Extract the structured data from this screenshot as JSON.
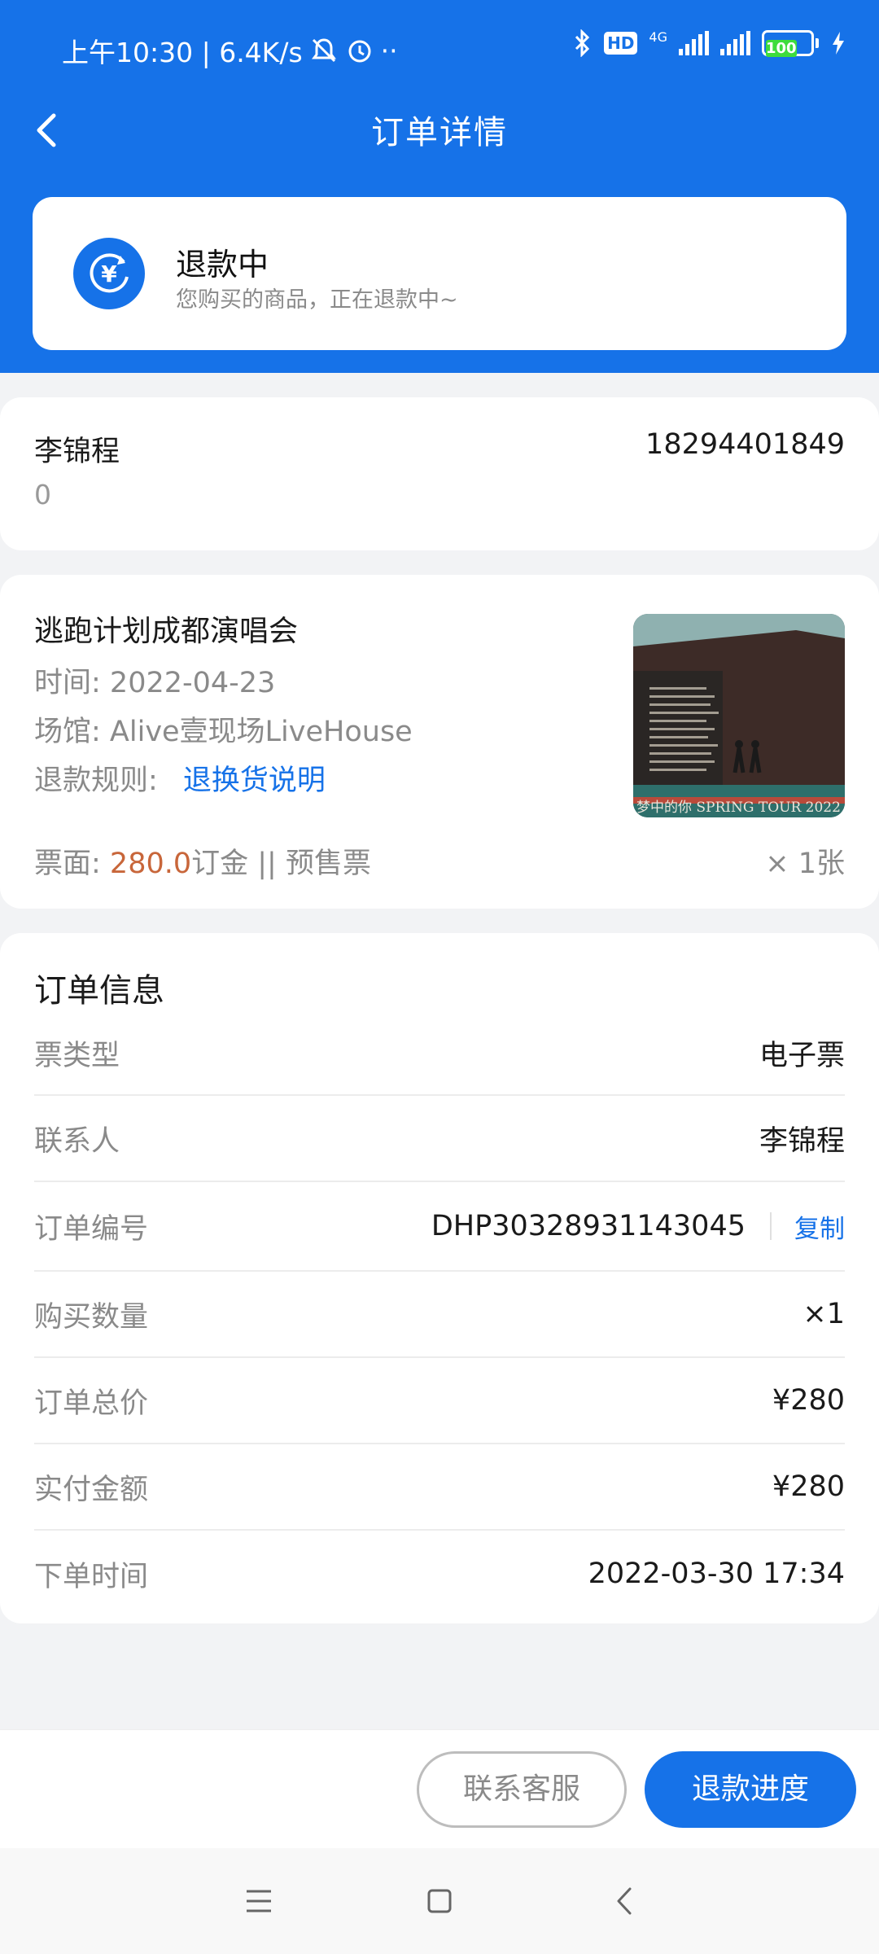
{
  "statusbar": {
    "time": "上午10:30 | 6.4K/s",
    "hd": "HD",
    "network": "4G",
    "battery": "100"
  },
  "nav": {
    "title": "订单详情"
  },
  "status": {
    "title": "退款中",
    "subtitle": "您购买的商品，正在退款中~"
  },
  "contact": {
    "name": "李锦程",
    "phone": "18294401849",
    "extra": "0"
  },
  "event": {
    "title": "逃跑计划成都演唱会",
    "time_label": "时间: ",
    "time": "2022-04-23",
    "venue_label": "场馆: ",
    "venue": "Alive壹现场LiveHouse",
    "refund_label": "退款规则: ",
    "refund_link": "退换货说明",
    "price_label": "票面: ",
    "price": "280.0",
    "price_suffix": "订金 || 预售票",
    "quantity": "× 1张",
    "poster_text": "梦中的你 SPRING TOUR 2022"
  },
  "order_info": {
    "title": "订单信息",
    "ticket_type_label": "票类型",
    "ticket_type": "电子票",
    "contact_label": "联系人",
    "contact": "李锦程",
    "order_no_label": "订单编号",
    "order_no": "DHP30328931143045",
    "copy_label": "复制",
    "quantity_label": "购买数量",
    "quantity": "×1",
    "total_label": "订单总价",
    "total": "¥280",
    "paid_label": "实付金额",
    "paid": "¥280",
    "time_label": "下单时间",
    "time": "2022-03-30 17:34"
  },
  "actions": {
    "service": "联系客服",
    "refund_progress": "退款进度"
  },
  "colors": {
    "primary": "#1672e8",
    "price": "#c8663a",
    "battery": "#3ddc3d"
  }
}
